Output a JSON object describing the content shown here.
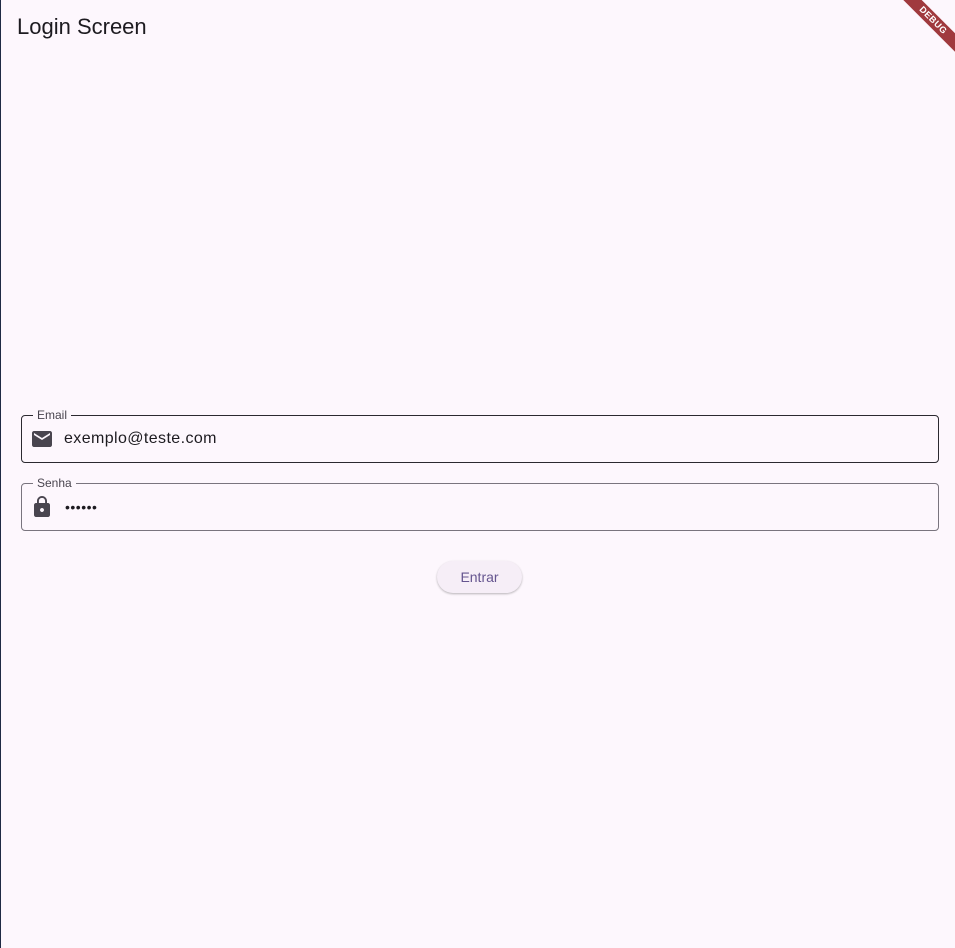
{
  "app_bar": {
    "title": "Login Screen"
  },
  "form": {
    "email": {
      "label": "Email",
      "value": "exemplo@teste.com",
      "icon": "mail-icon"
    },
    "password": {
      "label": "Senha",
      "value_masked": "••••••",
      "icon": "lock-icon"
    },
    "submit_label": "Entrar"
  },
  "debug_banner": {
    "label": "DEBUG"
  },
  "colors": {
    "background": "#fdf7fd",
    "text": "#1d1b20",
    "focused_border": "#2b2930",
    "outline": "#79747e",
    "button_text": "#65558f",
    "button_surface": "#f6eef7",
    "debug_ribbon": "#a03a3e"
  }
}
